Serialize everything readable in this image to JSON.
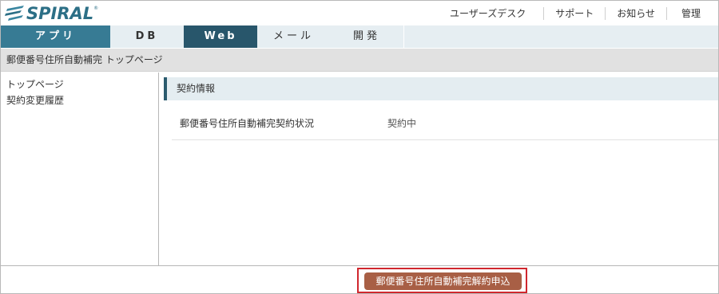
{
  "header": {
    "logo_text": "SPIRAL",
    "logo_reg": "®",
    "links": [
      "ユーザーズデスク",
      "サポート",
      "お知らせ",
      "管理"
    ]
  },
  "nav": {
    "tabs": [
      {
        "label": "アプリ"
      },
      {
        "label": "DB"
      },
      {
        "label": "Web"
      },
      {
        "label": "メール"
      },
      {
        "label": "開発"
      }
    ]
  },
  "breadcrumb": "郵便番号住所自動補完 トップページ",
  "sidebar": {
    "items": [
      {
        "label": "トップページ"
      },
      {
        "label": "契約変更履歴"
      }
    ]
  },
  "main": {
    "section_title": "契約情報",
    "rows": [
      {
        "label": "郵便番号住所自動補完契約状況",
        "value": "契約中"
      }
    ]
  },
  "footer": {
    "cancel_button": "郵便番号住所自動補完解約申込"
  },
  "colors": {
    "logo": "#2c6f86",
    "tab_active_app": "#377b94",
    "tab_active_web": "#28566b",
    "section_accent": "#2b5b6e",
    "cta_button": "#a85f45",
    "cta_highlight": "#d0272e"
  }
}
